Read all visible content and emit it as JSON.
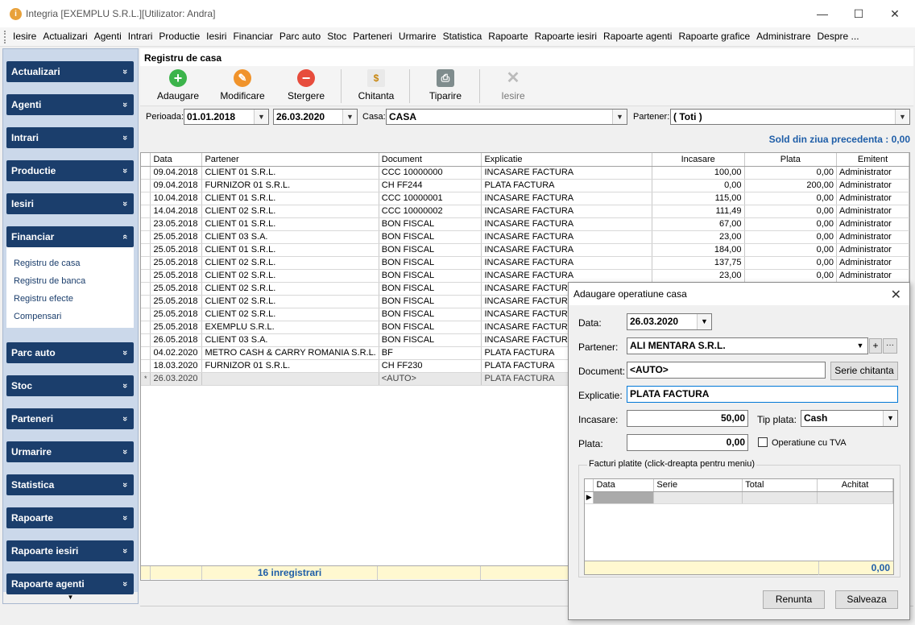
{
  "window": {
    "title": "Integria [EXEMPLU S.R.L.][Utilizator: Andra]",
    "minimize": "—",
    "maximize": "☐",
    "close": "✕"
  },
  "menu": [
    "Iesire",
    "Actualizari",
    "Agenti",
    "Intrari",
    "Productie",
    "Iesiri",
    "Financiar",
    "Parc auto",
    "Stoc",
    "Parteneri",
    "Urmarire",
    "Statistica",
    "Rapoarte",
    "Rapoarte iesiri",
    "Rapoarte agenti",
    "Rapoarte grafice",
    "Administrare",
    "Despre ..."
  ],
  "sidebar": {
    "sections": [
      "Actualizari",
      "Agenti",
      "Intrari",
      "Productie",
      "Iesiri",
      "Financiar",
      "Parc auto",
      "Stoc",
      "Parteneri",
      "Urmarire",
      "Statistica",
      "Rapoarte",
      "Rapoarte iesiri",
      "Rapoarte agenti"
    ],
    "financiar_items": [
      "Registru de casa",
      "Registru de banca",
      "Registru efecte",
      "Compensari"
    ],
    "chevron_down": "»",
    "chevron_up": "«",
    "scroll_down": "▼"
  },
  "main": {
    "title": "Registru de casa",
    "toolbar": {
      "add": "Adaugare",
      "edit": "Modificare",
      "delete": "Stergere",
      "receipt": "Chitanta",
      "print": "Tiparire",
      "exit": "Iesire"
    },
    "filters": {
      "period_label": "Perioada:",
      "date_from": "01.01.2018",
      "date_to": "26.03.2020",
      "casa_label": "Casa:",
      "casa_value": "CASA",
      "partner_label": "Partener:",
      "partner_value": "( Toti )"
    },
    "sold": "Sold din ziua precedenta : 0,00",
    "grid": {
      "columns": [
        "Data",
        "Partener",
        "Document",
        "Explicatie",
        "Incasare",
        "Plata",
        "Emitent"
      ],
      "rows": [
        [
          "09.04.2018",
          "CLIENT 01 S.R.L.",
          "CCC 10000000",
          "INCASARE FACTURA",
          "100,00",
          "0,00",
          "Administrator"
        ],
        [
          "09.04.2018",
          "FURNIZOR 01 S.R.L.",
          "CH FF244",
          "PLATA FACTURA",
          "0,00",
          "200,00",
          "Administrator"
        ],
        [
          "10.04.2018",
          "CLIENT 01 S.R.L.",
          "CCC 10000001",
          "INCASARE FACTURA",
          "115,00",
          "0,00",
          "Administrator"
        ],
        [
          "14.04.2018",
          "CLIENT 02 S.R.L.",
          "CCC 10000002",
          "INCASARE FACTURA",
          "111,49",
          "0,00",
          "Administrator"
        ],
        [
          "23.05.2018",
          "CLIENT 01 S.R.L.",
          "BON FISCAL",
          "INCASARE FACTURA",
          "67,00",
          "0,00",
          "Administrator"
        ],
        [
          "25.05.2018",
          "CLIENT 03 S.A.",
          "BON FISCAL",
          "INCASARE FACTURA",
          "23,00",
          "0,00",
          "Administrator"
        ],
        [
          "25.05.2018",
          "CLIENT 01 S.R.L.",
          "BON FISCAL",
          "INCASARE FACTURA",
          "184,00",
          "0,00",
          "Administrator"
        ],
        [
          "25.05.2018",
          "CLIENT 02 S.R.L.",
          "BON FISCAL",
          "INCASARE FACTURA",
          "137,75",
          "0,00",
          "Administrator"
        ],
        [
          "25.05.2018",
          "CLIENT 02 S.R.L.",
          "BON FISCAL",
          "INCASARE FACTURA",
          "23,00",
          "0,00",
          "Administrator"
        ],
        [
          "25.05.2018",
          "CLIENT 02 S.R.L.",
          "BON FISCAL",
          "INCASARE FACTURA",
          "",
          "",
          ""
        ],
        [
          "25.05.2018",
          "CLIENT 02 S.R.L.",
          "BON FISCAL",
          "INCASARE FACTURA",
          "",
          "",
          ""
        ],
        [
          "25.05.2018",
          "CLIENT 02 S.R.L.",
          "BON FISCAL",
          "INCASARE FACTURA",
          "",
          "",
          ""
        ],
        [
          "25.05.2018",
          "EXEMPLU S.R.L.",
          "BON FISCAL",
          "INCASARE FACTURA",
          "",
          "",
          ""
        ],
        [
          "26.05.2018",
          "CLIENT 03 S.A.",
          "BON FISCAL",
          "INCASARE FACTURA",
          "",
          "",
          ""
        ],
        [
          "04.02.2020",
          "METRO CASH & CARRY ROMANIA S.R.L.",
          "BF",
          "PLATA FACTURA",
          "",
          "",
          ""
        ],
        [
          "18.03.2020",
          "FURNIZOR 01 S.R.L.",
          "CH FF230",
          "PLATA FACTURA",
          "",
          "",
          ""
        ]
      ],
      "new_row": [
        "26.03.2020",
        "",
        "<AUTO>",
        "PLATA FACTURA",
        "",
        "",
        ""
      ],
      "new_row_marker": "*",
      "footer_count": "16 inregistrari"
    }
  },
  "dialog": {
    "title": "Adaugare operatiune casa",
    "close": "✕",
    "data_label": "Data:",
    "data_value": "26.03.2020",
    "partner_label": "Partener:",
    "partner_value": "ALI MENTARA S.R.L.",
    "partner_add": "+",
    "partner_more": "···",
    "document_label": "Document:",
    "document_value": "<AUTO>",
    "serie_button": "Serie chitanta",
    "explicatie_label": "Explicatie:",
    "explicatie_value": "PLATA FACTURA",
    "incasare_label": "Incasare:",
    "incasare_value": "50,00",
    "tip_plata_label": "Tip plata:",
    "tip_plata_value": "Cash",
    "plata_label": "Plata:",
    "plata_value": "0,00",
    "tva_label": "Operatiune cu TVA",
    "facturi_legend": "Facturi platite (click-dreapta pentru meniu)",
    "facturi_columns": [
      "Data",
      "Serie",
      "Total",
      "Achitat"
    ],
    "facturi_total": "0,00",
    "cancel": "Renunta",
    "save": "Salveaza"
  },
  "colors": {
    "sidebar_header": "#1b3e6c",
    "accent_blue": "#1f5ea8",
    "footer_yellow": "#fff8d0"
  }
}
